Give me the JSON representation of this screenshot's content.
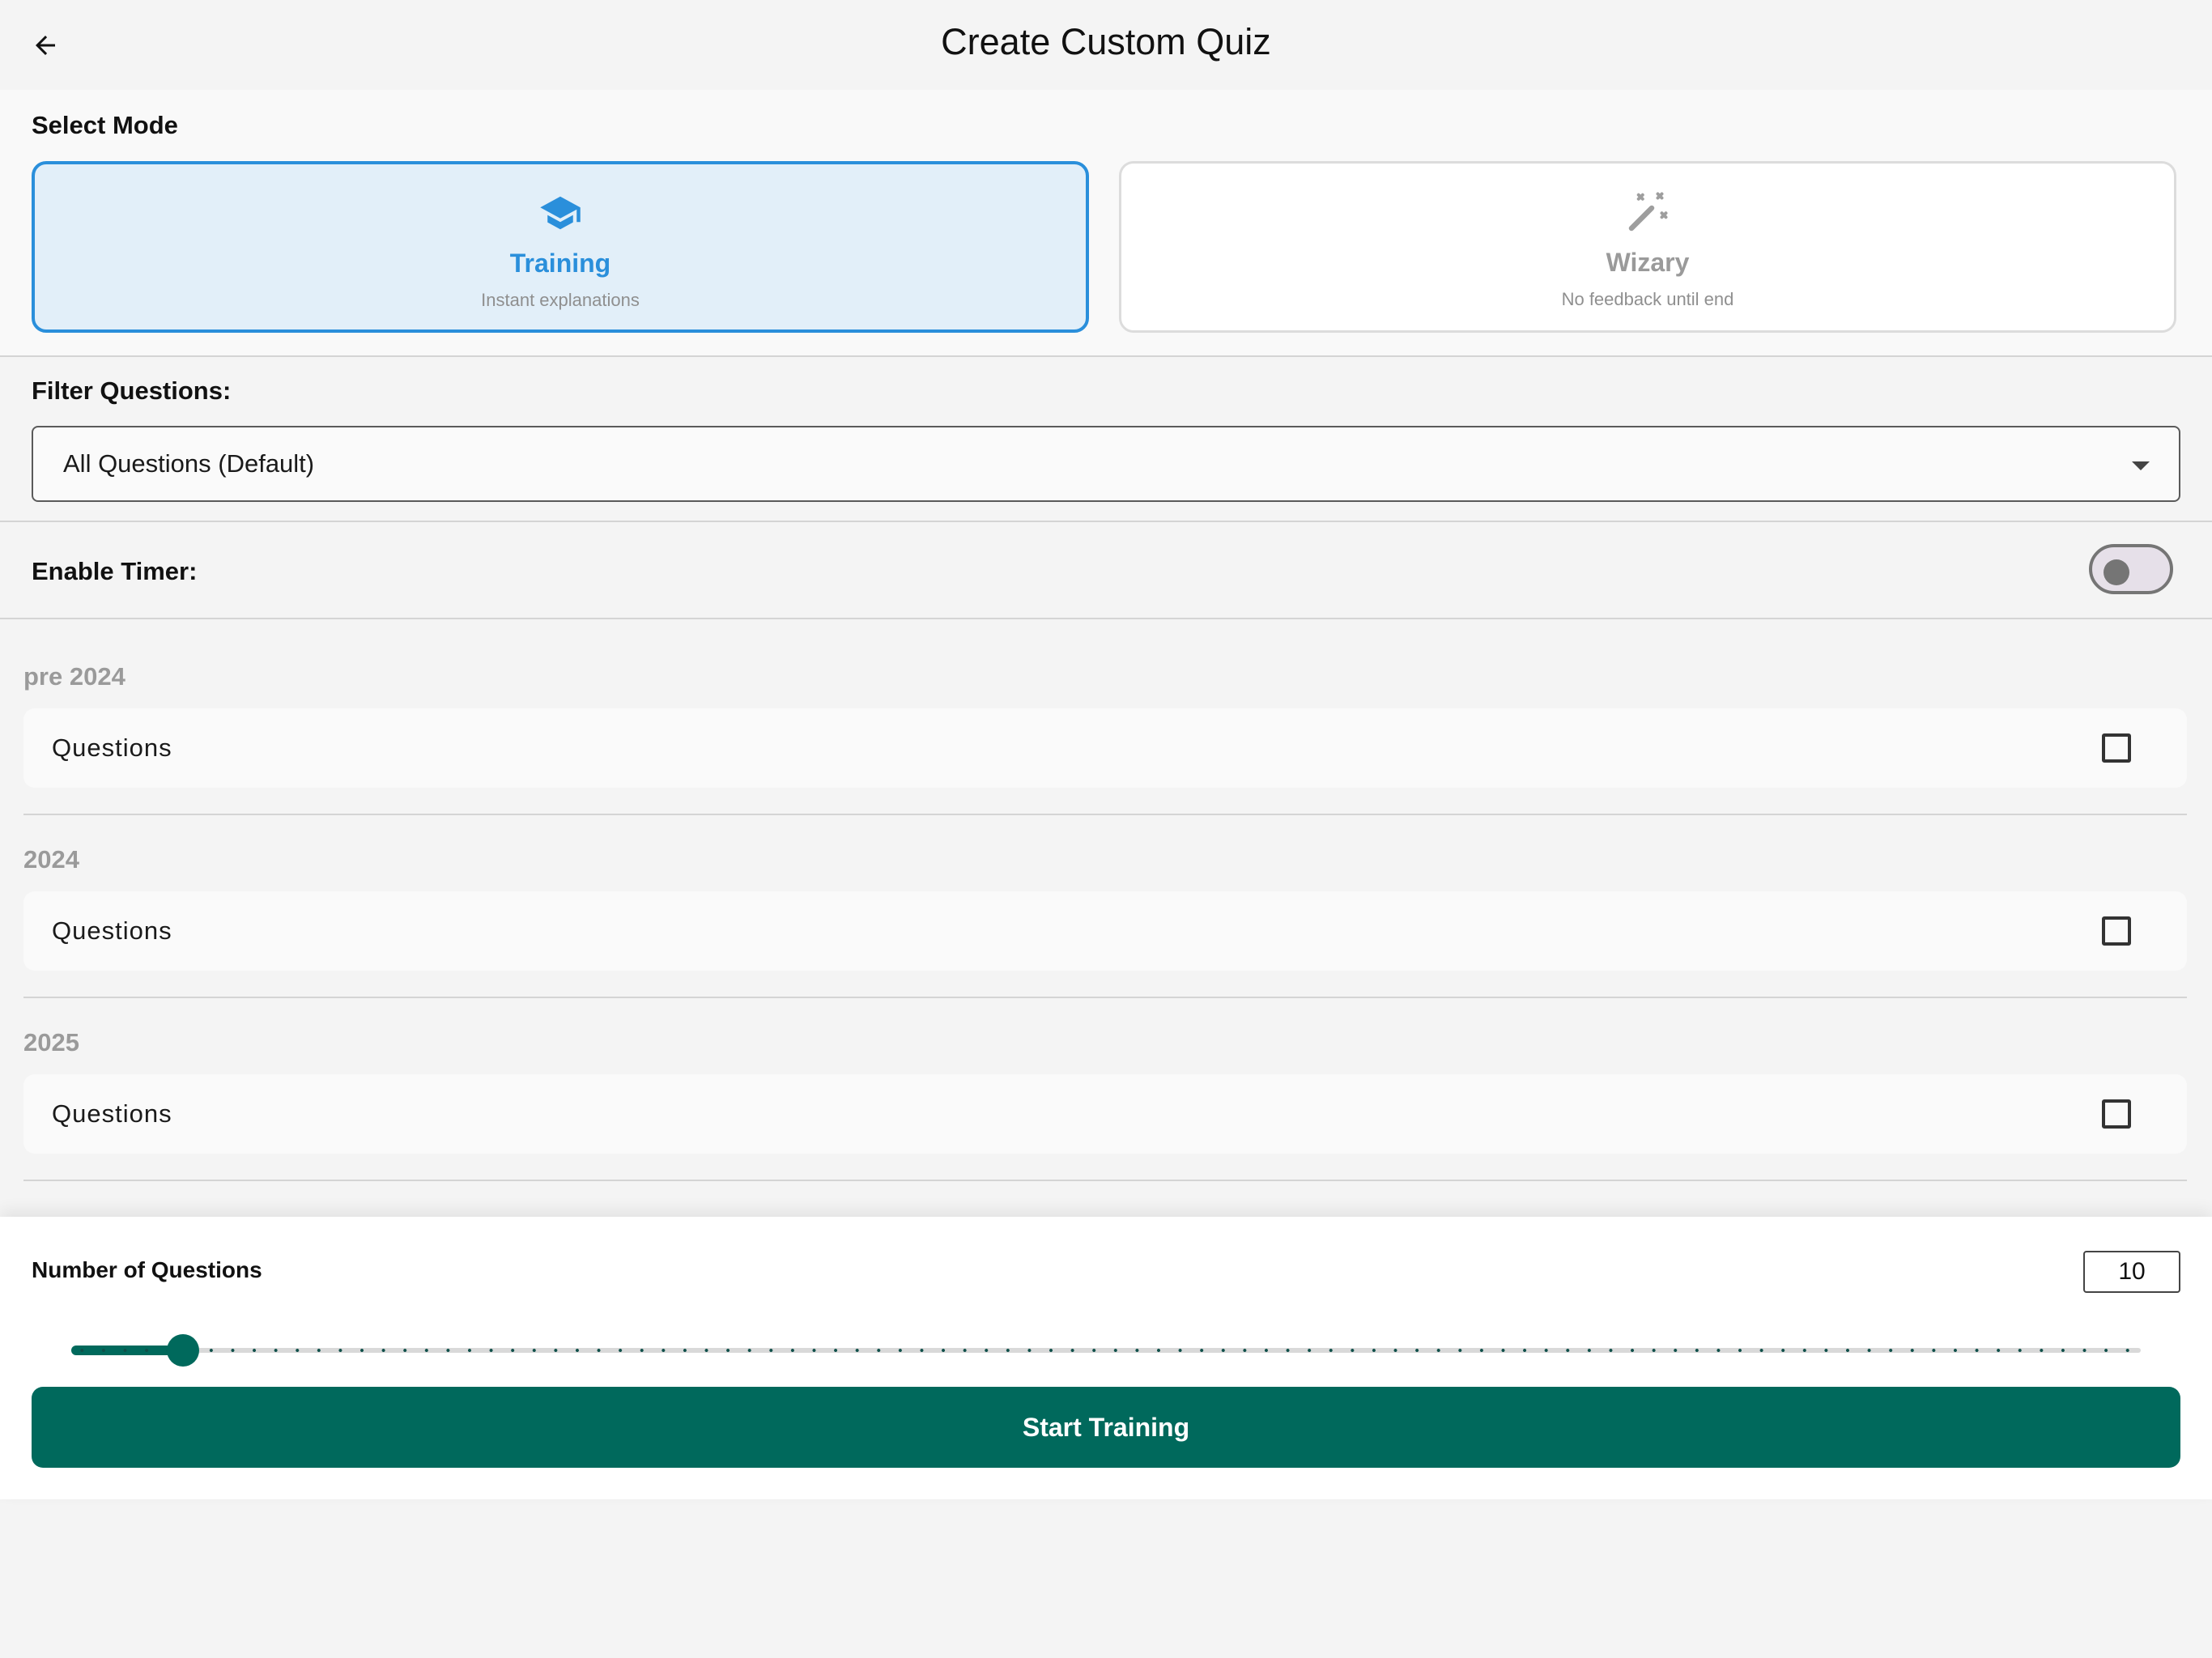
{
  "header": {
    "title": "Create Custom Quiz",
    "back_icon": "arrow-left-icon"
  },
  "mode": {
    "label": "Select Mode",
    "options": [
      {
        "title": "Training",
        "description": "Instant explanations",
        "icon": "graduation-cap-icon",
        "selected": true,
        "accent": "#2a8fdb"
      },
      {
        "title": "Wizary",
        "description": "No feedback until end",
        "icon": "magic-wand-icon",
        "selected": false
      }
    ]
  },
  "filter": {
    "label": "Filter Questions:",
    "value": "All Questions (Default)"
  },
  "timer": {
    "label": "Enable Timer:",
    "enabled": false
  },
  "groups": [
    {
      "year": "pre 2024",
      "item_label": "Questions",
      "checked": false
    },
    {
      "year": "2024",
      "item_label": "Questions",
      "checked": false
    },
    {
      "year": "2025",
      "item_label": "Questions",
      "checked": false
    }
  ],
  "count": {
    "label": "Number of Questions",
    "value": "10",
    "slider_fraction": 0.054
  },
  "action": {
    "label": "Start Training",
    "color": "#00695c"
  }
}
